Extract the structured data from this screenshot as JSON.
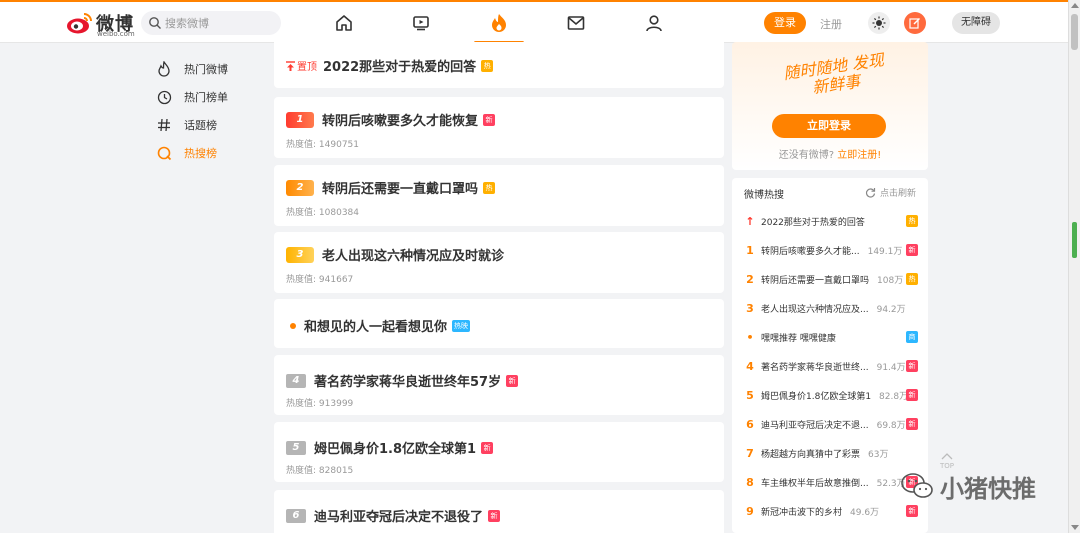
{
  "colors": {
    "accent": "#ff8200",
    "hot": "#ffb000",
    "new": "#ff4060",
    "rec": "#2db7ff"
  },
  "header": {
    "logo_text": "微博",
    "logo_sub": "weibo.com",
    "search_placeholder": "搜索微博",
    "nav_icons": [
      "home-icon",
      "video-icon",
      "hot-flame-icon",
      "mail-icon",
      "profile-icon"
    ],
    "login_label": "登录",
    "register_label": "注册",
    "accessibility_label": "无障碍"
  },
  "sidebar": {
    "items": [
      {
        "label": "热门微博",
        "icon": "flame-outline-icon"
      },
      {
        "label": "热门榜单",
        "icon": "clock-icon"
      },
      {
        "label": "话题榜",
        "icon": "hash-icon"
      },
      {
        "label": "热搜榜",
        "icon": "search-q-icon",
        "active": true
      }
    ]
  },
  "feed": {
    "heat_prefix": "热度值:",
    "pinned": {
      "tag": "置顶",
      "title": "2022那些对于热爱的回答",
      "badge": "热"
    },
    "items": [
      {
        "rank": "1",
        "title": "转阴后咳嗽要多久才能恢复",
        "badge": "新",
        "badge_type": "new",
        "heat": "1490751"
      },
      {
        "rank": "2",
        "title": "转阴后还需要一直戴口罩吗",
        "badge": "热",
        "badge_type": "hot",
        "heat": "1080384"
      },
      {
        "rank": "3",
        "title": "老人出现这六种情况应及时就诊",
        "badge": "",
        "badge_type": "",
        "heat": "941667"
      },
      {
        "rank": "",
        "title": "和想见的人一起看想见你",
        "badge": "热映",
        "badge_type": "rec",
        "heat": ""
      },
      {
        "rank": "4",
        "title": "著名药学家蒋华良逝世终年57岁",
        "badge": "新",
        "badge_type": "new",
        "heat": "913999"
      },
      {
        "rank": "5",
        "title": "姆巴佩身价1.8亿欧全球第1",
        "badge": "新",
        "badge_type": "new",
        "heat": "828015"
      },
      {
        "rank": "6",
        "title": "迪马利亚夺冠后决定不退役了",
        "badge": "新",
        "badge_type": "new",
        "heat": ""
      }
    ]
  },
  "promo": {
    "slogan": "随时随地 发现新鲜事",
    "login_button": "立即登录",
    "no_account": "还没有微博?",
    "register_now": "立即注册!"
  },
  "hotlist": {
    "title": "微博热搜",
    "refresh": "点击刷新",
    "rows": [
      {
        "rank": "↑",
        "text": "2022那些对于热爱的回答",
        "num": "",
        "badge": "热",
        "badge_type": "hot"
      },
      {
        "rank": "1",
        "text": "转阴后咳嗽要多久才能...",
        "num": "149.1万",
        "badge": "新",
        "badge_type": "new"
      },
      {
        "rank": "2",
        "text": "转阴后还需要一直戴口罩吗",
        "num": "108万",
        "badge": "热",
        "badge_type": "hot"
      },
      {
        "rank": "3",
        "text": "老人出现这六种情况应及...",
        "num": "94.2万",
        "badge": "",
        "badge_type": ""
      },
      {
        "rank": "•",
        "text": "嘿嘿推荐 嘿嘿健康",
        "num": "",
        "badge": "商",
        "badge_type": "rec"
      },
      {
        "rank": "4",
        "text": "著名药学家蒋华良逝世终...",
        "num": "91.4万",
        "badge": "新",
        "badge_type": "new"
      },
      {
        "rank": "5",
        "text": "姆巴佩身价1.8亿欧全球第1",
        "num": "82.8万",
        "badge": "新",
        "badge_type": "new"
      },
      {
        "rank": "6",
        "text": "迪马利亚夺冠后决定不退...",
        "num": "69.8万",
        "badge": "新",
        "badge_type": "new"
      },
      {
        "rank": "7",
        "text": "杨超越方向真猜中了彩票",
        "num": "63万",
        "badge": "",
        "badge_type": ""
      },
      {
        "rank": "8",
        "text": "车主维权半年后故意推倒...",
        "num": "52.3万",
        "badge": "新",
        "badge_type": "new"
      },
      {
        "rank": "9",
        "text": "新冠冲击波下的乡村",
        "num": "49.6万",
        "badge": "新",
        "badge_type": "new"
      }
    ]
  },
  "backtop_label": "TOP",
  "watermark": "小猪快推"
}
